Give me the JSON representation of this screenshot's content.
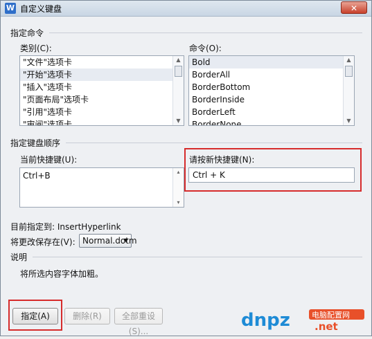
{
  "window": {
    "title": "自定义键盘",
    "app_icon": "W"
  },
  "close_button": "✕",
  "specify_command": {
    "section_label": "指定命令",
    "category_label": "类别(C):",
    "categories": [
      "\"文件\"选项卡",
      "\"开始\"选项卡",
      "\"插入\"选项卡",
      "\"页面布局\"选项卡",
      "\"引用\"选项卡",
      "\"审阅\"选项卡"
    ],
    "selected_category_index": 1,
    "command_label": "命令(O):",
    "commands": [
      "Bold",
      "BorderAll",
      "BorderBottom",
      "BorderInside",
      "BorderLeft",
      "BorderNone"
    ],
    "selected_command_index": 0
  },
  "keyboard_order": {
    "section_label": "指定键盘顺序",
    "current_label": "当前快捷键(U):",
    "current_value": "Ctrl+B",
    "new_label": "请按新快捷键(N):",
    "new_value": "Ctrl + K"
  },
  "currently_assigned": {
    "label": "目前指定到:",
    "value": "InsertHyperlink"
  },
  "save_in": {
    "label": "将更改保存在(V):",
    "value": "Normal.dotm"
  },
  "description": {
    "section_label": "说明",
    "text": "将所选内容字体加粗。"
  },
  "buttons": {
    "assign": "指定(A)",
    "remove": "删除(R)",
    "reset_all": "全部重设(S)..."
  },
  "colors": {
    "highlight_red": "#d62b2b"
  },
  "watermark": {
    "text_main": "dnpz",
    "text_sub": "电脑配置网",
    "text_url": ".net"
  }
}
